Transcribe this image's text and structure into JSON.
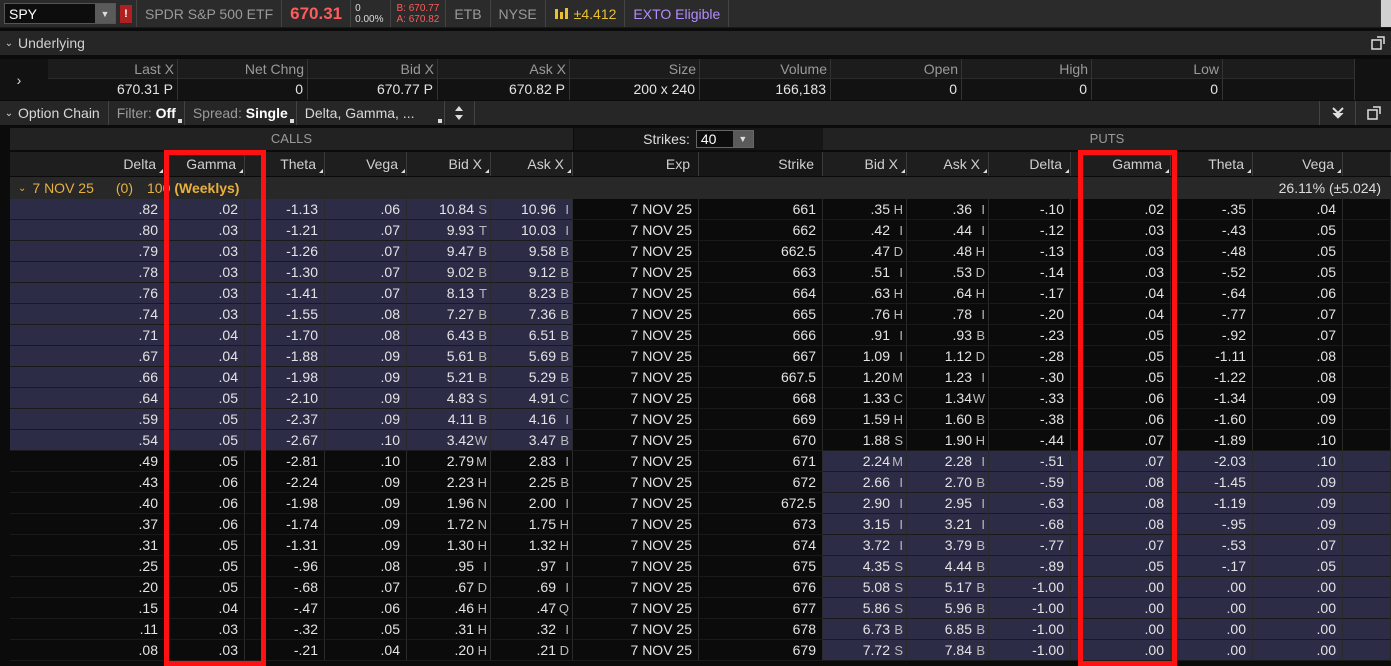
{
  "topbar": {
    "symbol": "SPY",
    "alert_badge": "!",
    "name": "SPDR S&P 500 ETF",
    "last": "670.31",
    "change": "0",
    "change_pct": "0.00%",
    "bid": "B: 670.77",
    "ask": "A: 670.82",
    "etb": "ETB",
    "exchange": "NYSE",
    "mmm_label": "±4.412",
    "exto": "EXTO Eligible"
  },
  "underlying": {
    "title": "Underlying",
    "headers": [
      "Last X",
      "Net Chng",
      "Bid X",
      "Ask X",
      "Size",
      "Volume",
      "Open",
      "High",
      "Low"
    ],
    "values": {
      "last": "670.31",
      "last_x": "P",
      "net_chng": "0",
      "bid": "670.77",
      "bid_x": "P",
      "ask": "670.82",
      "ask_x": "P",
      "size": "200 x 240",
      "volume": "166,183",
      "open": "0",
      "high": "0",
      "low": "0"
    }
  },
  "option_chain": {
    "title": "Option Chain",
    "filter_label": "Filter:",
    "filter_value": "Off",
    "spread_label": "Spread:",
    "spread_value": "Single",
    "layout_value": "Delta, Gamma, ...",
    "calls_title": "CALLS",
    "puts_title": "PUTS",
    "strikes_label": "Strikes:",
    "strikes_value": "40",
    "call_headers": {
      "delta": "Delta",
      "gamma": "Gamma",
      "theta": "Theta",
      "vega": "Vega",
      "bid": "Bid X",
      "ask": "Ask X"
    },
    "mid_headers": {
      "exp": "Exp",
      "strike": "Strike"
    },
    "put_headers": {
      "bid": "Bid X",
      "ask": "Ask X",
      "delta": "Delta",
      "gamma": "Gamma",
      "theta": "Theta",
      "vega": "Vega"
    },
    "series": {
      "date": "7 NOV 25",
      "count": "(0)",
      "multiplier": "100",
      "weeklys": "(Weeklys)",
      "iv": "26.11% (±5.024)"
    },
    "rows": [
      [
        "itm",
        ".82",
        ".02",
        "-1.13",
        ".06",
        "10.84",
        "S",
        "10.96",
        "I",
        "7 NOV 25",
        "661",
        ".35",
        "H",
        ".36",
        "I",
        "-.10",
        ".02",
        "-.35",
        ".04"
      ],
      [
        "itm",
        ".80",
        ".03",
        "-1.21",
        ".07",
        "9.93",
        "T",
        "10.03",
        "I",
        "7 NOV 25",
        "662",
        ".42",
        "I",
        ".44",
        "I",
        "-.12",
        ".03",
        "-.43",
        ".05"
      ],
      [
        "itm",
        ".79",
        ".03",
        "-1.26",
        ".07",
        "9.47",
        "B",
        "9.58",
        "B",
        "7 NOV 25",
        "662.5",
        ".47",
        "D",
        ".48",
        "H",
        "-.13",
        ".03",
        "-.48",
        ".05"
      ],
      [
        "itm",
        ".78",
        ".03",
        "-1.30",
        ".07",
        "9.02",
        "B",
        "9.12",
        "B",
        "7 NOV 25",
        "663",
        ".51",
        "I",
        ".53",
        "D",
        "-.14",
        ".03",
        "-.52",
        ".05"
      ],
      [
        "itm",
        ".76",
        ".03",
        "-1.41",
        ".07",
        "8.13",
        "T",
        "8.23",
        "B",
        "7 NOV 25",
        "664",
        ".63",
        "H",
        ".64",
        "H",
        "-.17",
        ".04",
        "-.64",
        ".06"
      ],
      [
        "itm",
        ".74",
        ".03",
        "-1.55",
        ".08",
        "7.27",
        "B",
        "7.36",
        "B",
        "7 NOV 25",
        "665",
        ".76",
        "H",
        ".78",
        "I",
        "-.20",
        ".04",
        "-.77",
        ".07"
      ],
      [
        "itm",
        ".71",
        ".04",
        "-1.70",
        ".08",
        "6.43",
        "B",
        "6.51",
        "B",
        "7 NOV 25",
        "666",
        ".91",
        "I",
        ".93",
        "B",
        "-.23",
        ".05",
        "-.92",
        ".07"
      ],
      [
        "itm",
        ".67",
        ".04",
        "-1.88",
        ".09",
        "5.61",
        "B",
        "5.69",
        "B",
        "7 NOV 25",
        "667",
        "1.09",
        "I",
        "1.12",
        "D",
        "-.28",
        ".05",
        "-1.11",
        ".08"
      ],
      [
        "itm",
        ".66",
        ".04",
        "-1.98",
        ".09",
        "5.21",
        "B",
        "5.29",
        "B",
        "7 NOV 25",
        "667.5",
        "1.20",
        "M",
        "1.23",
        "I",
        "-.30",
        ".05",
        "-1.22",
        ".08"
      ],
      [
        "itm",
        ".64",
        ".05",
        "-2.10",
        ".09",
        "4.83",
        "S",
        "4.91",
        "C",
        "7 NOV 25",
        "668",
        "1.33",
        "C",
        "1.34",
        "W",
        "-.33",
        ".06",
        "-1.34",
        ".09"
      ],
      [
        "itm",
        ".59",
        ".05",
        "-2.37",
        ".09",
        "4.11",
        "B",
        "4.16",
        "I",
        "7 NOV 25",
        "669",
        "1.59",
        "H",
        "1.60",
        "B",
        "-.38",
        ".06",
        "-1.60",
        ".09"
      ],
      [
        "itm",
        ".54",
        ".05",
        "-2.67",
        ".10",
        "3.42",
        "W",
        "3.47",
        "B",
        "7 NOV 25",
        "670",
        "1.88",
        "S",
        "1.90",
        "H",
        "-.44",
        ".07",
        "-1.89",
        ".10"
      ],
      [
        "otm",
        ".49",
        ".05",
        "-2.81",
        ".10",
        "2.79",
        "M",
        "2.83",
        "I",
        "7 NOV 25",
        "671",
        "2.24",
        "M",
        "2.28",
        "I",
        "-.51",
        ".07",
        "-2.03",
        ".10"
      ],
      [
        "otm",
        ".43",
        ".06",
        "-2.24",
        ".09",
        "2.23",
        "H",
        "2.25",
        "B",
        "7 NOV 25",
        "672",
        "2.66",
        "I",
        "2.70",
        "B",
        "-.59",
        ".08",
        "-1.45",
        ".09"
      ],
      [
        "otm",
        ".40",
        ".06",
        "-1.98",
        ".09",
        "1.96",
        "N",
        "2.00",
        "I",
        "7 NOV 25",
        "672.5",
        "2.90",
        "I",
        "2.95",
        "I",
        "-.63",
        ".08",
        "-1.19",
        ".09"
      ],
      [
        "otm",
        ".37",
        ".06",
        "-1.74",
        ".09",
        "1.72",
        "N",
        "1.75",
        "H",
        "7 NOV 25",
        "673",
        "3.15",
        "I",
        "3.21",
        "I",
        "-.68",
        ".08",
        "-.95",
        ".09"
      ],
      [
        "otm",
        ".31",
        ".05",
        "-1.31",
        ".09",
        "1.30",
        "H",
        "1.32",
        "H",
        "7 NOV 25",
        "674",
        "3.72",
        "I",
        "3.79",
        "B",
        "-.77",
        ".07",
        "-.53",
        ".07"
      ],
      [
        "otm",
        ".25",
        ".05",
        "-.96",
        ".08",
        ".95",
        "I",
        ".97",
        "I",
        "7 NOV 25",
        "675",
        "4.35",
        "S",
        "4.44",
        "B",
        "-.89",
        ".05",
        "-.17",
        ".05"
      ],
      [
        "otm",
        ".20",
        ".05",
        "-.68",
        ".07",
        ".67",
        "D",
        ".69",
        "I",
        "7 NOV 25",
        "676",
        "5.08",
        "S",
        "5.17",
        "B",
        "-1.00",
        ".00",
        ".00",
        ".00"
      ],
      [
        "otm",
        ".15",
        ".04",
        "-.47",
        ".06",
        ".46",
        "H",
        ".47",
        "Q",
        "7 NOV 25",
        "677",
        "5.86",
        "S",
        "5.96",
        "B",
        "-1.00",
        ".00",
        ".00",
        ".00"
      ],
      [
        "otm",
        ".11",
        ".03",
        "-.32",
        ".05",
        ".31",
        "H",
        ".32",
        "I",
        "7 NOV 25",
        "678",
        "6.73",
        "B",
        "6.85",
        "B",
        "-1.00",
        ".00",
        ".00",
        ".00"
      ],
      [
        "otm",
        ".08",
        ".03",
        "-.21",
        ".04",
        ".20",
        "H",
        ".21",
        "D",
        "7 NOV 25",
        "679",
        "7.72",
        "S",
        "7.84",
        "B",
        "-1.00",
        ".00",
        ".00",
        ".00"
      ]
    ]
  },
  "colors": {
    "itm": "#2d2c47",
    "highlight": "#ff1111",
    "last_price": "#ff5b5b",
    "series": "#e8b040"
  }
}
